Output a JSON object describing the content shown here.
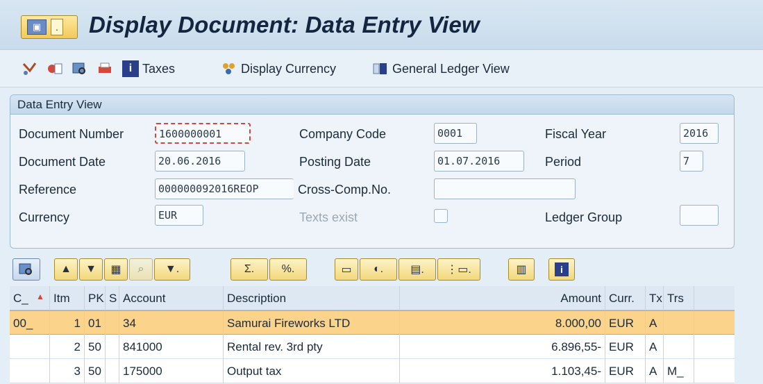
{
  "window": {
    "title": "Display Document: Data Entry View"
  },
  "toolbar": {
    "taxes_label": "Taxes",
    "display_currency_label": "Display Currency",
    "general_ledger_view_label": "General Ledger View"
  },
  "group": {
    "title": "Data Entry View",
    "document_number_label": "Document Number",
    "document_number_value": "1600000001",
    "company_code_label": "Company Code",
    "company_code_value": "0001",
    "fiscal_year_label": "Fiscal Year",
    "fiscal_year_value": "2016",
    "document_date_label": "Document Date",
    "document_date_value": "20.06.2016",
    "posting_date_label": "Posting Date",
    "posting_date_value": "01.07.2016",
    "period_label": "Period",
    "period_value": "7",
    "reference_label": "Reference",
    "reference_value": "000000092016REOP",
    "cross_comp_label": "Cross-Comp.No.",
    "cross_comp_value": "",
    "currency_label": "Currency",
    "currency_value": "EUR",
    "texts_exist_label": "Texts exist",
    "ledger_group_label": "Ledger Group",
    "ledger_group_value": ""
  },
  "table": {
    "headers": {
      "c": "C_",
      "itm": "Itm",
      "pk": "PK",
      "s": "S",
      "account": "Account",
      "description": "Description",
      "blank": "",
      "amount": "Amount",
      "curr": "Curr.",
      "tx": "Tx",
      "trs": "Trs"
    },
    "rows": [
      {
        "c": "00_",
        "itm": "1",
        "pk": "01",
        "s": "",
        "account": "34",
        "description": "Samurai Fireworks LTD",
        "amount": "8.000,00",
        "curr": "EUR",
        "tx": "A",
        "trs": ""
      },
      {
        "c": "",
        "itm": "2",
        "pk": "50",
        "s": "",
        "account": "841000",
        "description": "Rental rev. 3rd pty",
        "amount": "6.896,55-",
        "curr": "EUR",
        "tx": "A",
        "trs": ""
      },
      {
        "c": "",
        "itm": "3",
        "pk": "50",
        "s": "",
        "account": "175000",
        "description": "Output tax",
        "amount": "1.103,45-",
        "curr": "EUR",
        "tx": "A",
        "trs": "M_"
      }
    ]
  },
  "colors": {
    "selected_row": "#fbd38a",
    "accent_button": "#f2d87a",
    "focus_border": "#d4453a"
  }
}
